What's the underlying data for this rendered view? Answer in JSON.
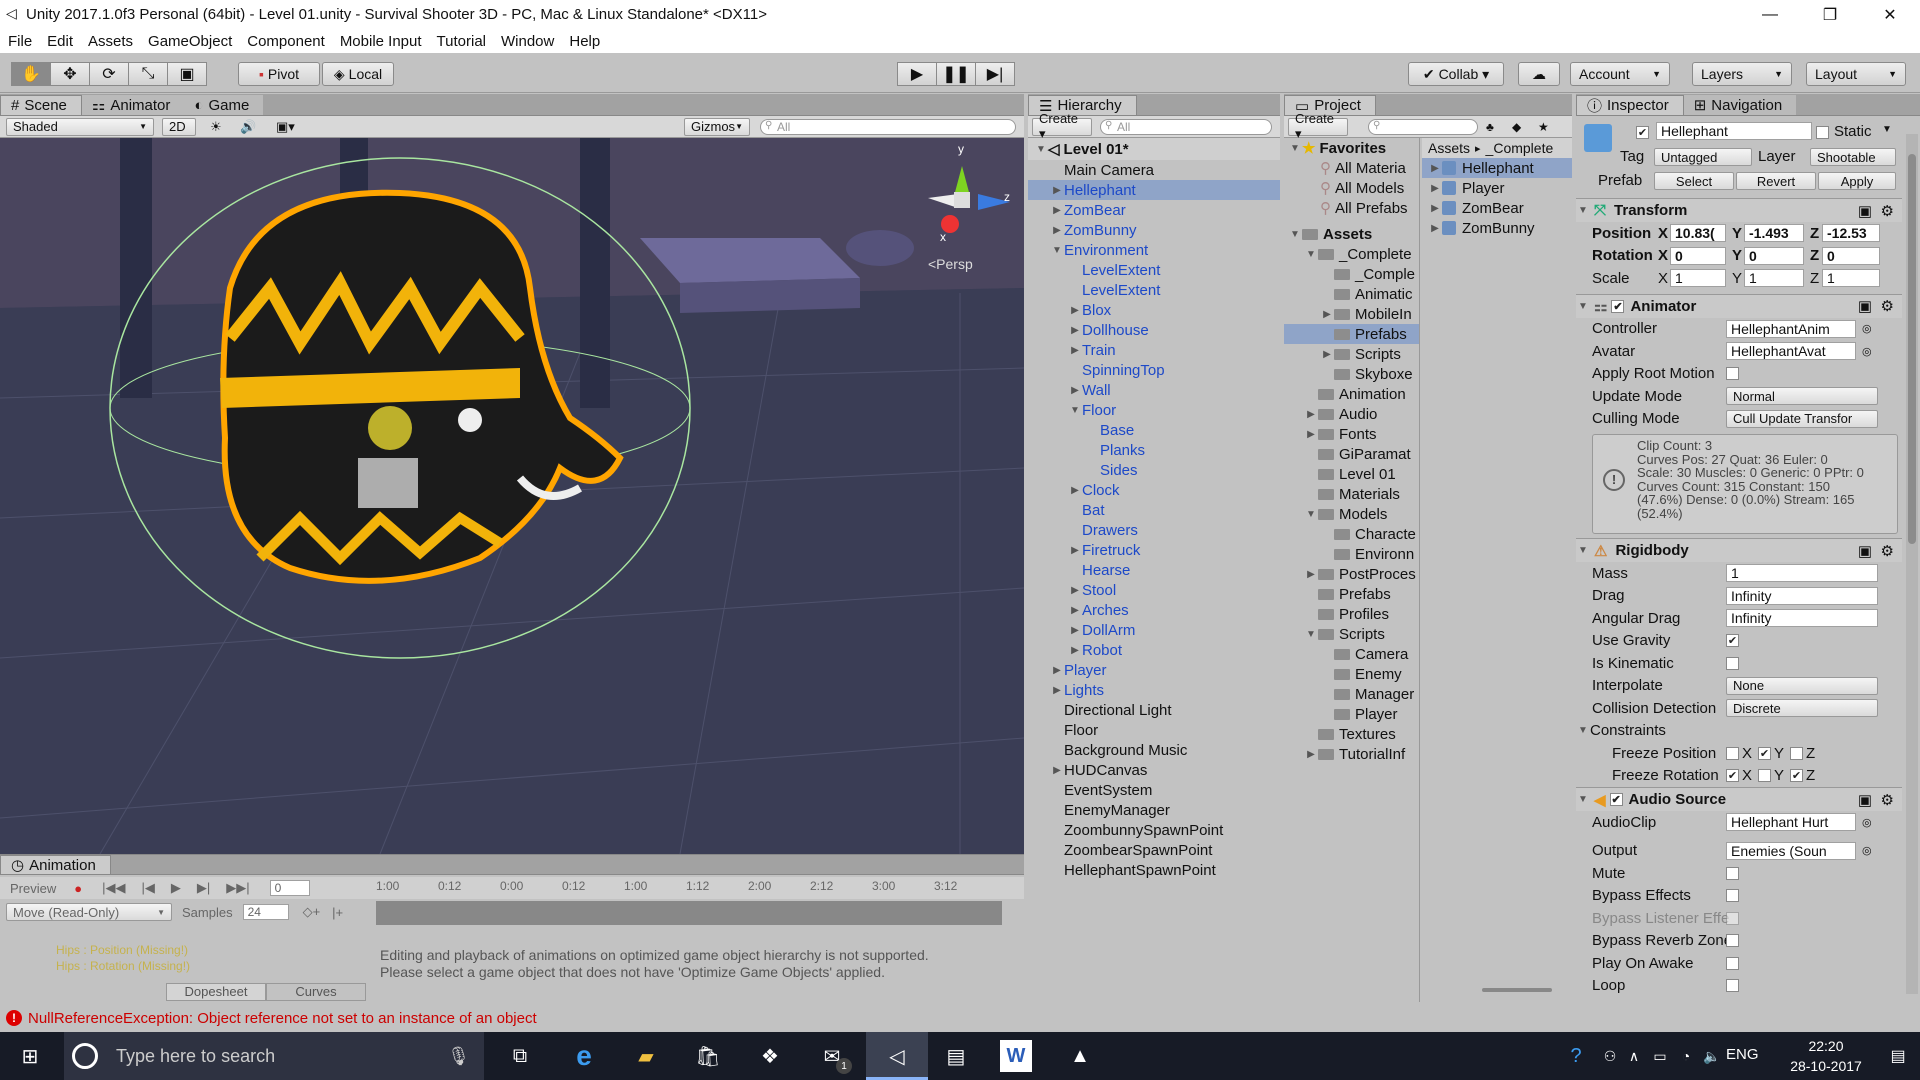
{
  "window": {
    "title": "Unity 2017.1.0f3 Personal (64bit) - Level 01.unity - Survival Shooter 3D - PC, Mac & Linux Standalone* <DX11>",
    "minimize": "—",
    "maximize": "❐",
    "close": "✕"
  },
  "menu": [
    "File",
    "Edit",
    "Assets",
    "GameObject",
    "Component",
    "Mobile Input",
    "Tutorial",
    "Window",
    "Help"
  ],
  "toolbar": {
    "pivot": "Pivot",
    "local": "Local",
    "collab": "Collab ▾",
    "account": "Account",
    "layers": "Layers",
    "layout": "Layout"
  },
  "scene": {
    "tabs": [
      "Scene",
      "Animator",
      "Game"
    ],
    "shading": "Shaded",
    "mode2d": "2D",
    "gizmos": "Gizmos",
    "search_placeholder": "All",
    "persp": "<Persp",
    "axis_y": "y",
    "axis_z": "z",
    "axis_x": "x"
  },
  "animation": {
    "tab": "Animation",
    "preview": "Preview",
    "frame": "0",
    "clip": "Move (Read-Only)",
    "samples_label": "Samples",
    "samples": "24",
    "ticks": [
      "1:00",
      "0:12",
      "0:00",
      "0:12",
      "1:00",
      "1:12",
      "2:00",
      "2:12",
      "3:00",
      "3:12"
    ],
    "tracks": [
      "Hips : Position (Missing!)",
      "Hips : Rotation (Missing!)"
    ],
    "message_1": "Editing and playback of animations on optimized game object hierarchy is not supported.",
    "message_2": "Please select a game object that does not have 'Optimize Game Objects' applied.",
    "dopesheet": "Dopesheet",
    "curves": "Curves"
  },
  "hierarchy": {
    "tab": "Hierarchy",
    "create": "Create ▾",
    "search_placeholder": "All",
    "scene": "Level 01*",
    "items": [
      {
        "label": "Main Camera",
        "indent": 0,
        "arrow": "",
        "blue": false,
        "sel": false
      },
      {
        "label": "Hellephant",
        "indent": 0,
        "arrow": "▶",
        "blue": true,
        "sel": true
      },
      {
        "label": "ZomBear",
        "indent": 0,
        "arrow": "▶",
        "blue": true,
        "sel": false
      },
      {
        "label": "ZomBunny",
        "indent": 0,
        "arrow": "▶",
        "blue": true,
        "sel": false
      },
      {
        "label": "Environment",
        "indent": 0,
        "arrow": "▼",
        "blue": true,
        "sel": false
      },
      {
        "label": "LevelExtent",
        "indent": 1,
        "arrow": "",
        "blue": true,
        "sel": false
      },
      {
        "label": "LevelExtent",
        "indent": 1,
        "arrow": "",
        "blue": true,
        "sel": false
      },
      {
        "label": "Blox",
        "indent": 1,
        "arrow": "▶",
        "blue": true,
        "sel": false
      },
      {
        "label": "Dollhouse",
        "indent": 1,
        "arrow": "▶",
        "blue": true,
        "sel": false
      },
      {
        "label": "Train",
        "indent": 1,
        "arrow": "▶",
        "blue": true,
        "sel": false
      },
      {
        "label": "SpinningTop",
        "indent": 1,
        "arrow": "",
        "blue": true,
        "sel": false
      },
      {
        "label": "Wall",
        "indent": 1,
        "arrow": "▶",
        "blue": true,
        "sel": false
      },
      {
        "label": "Floor",
        "indent": 1,
        "arrow": "▼",
        "blue": true,
        "sel": false
      },
      {
        "label": "Base",
        "indent": 2,
        "arrow": "",
        "blue": true,
        "sel": false
      },
      {
        "label": "Planks",
        "indent": 2,
        "arrow": "",
        "blue": true,
        "sel": false
      },
      {
        "label": "Sides",
        "indent": 2,
        "arrow": "",
        "blue": true,
        "sel": false
      },
      {
        "label": "Clock",
        "indent": 1,
        "arrow": "▶",
        "blue": true,
        "sel": false
      },
      {
        "label": "Bat",
        "indent": 1,
        "arrow": "",
        "blue": true,
        "sel": false
      },
      {
        "label": "Drawers",
        "indent": 1,
        "arrow": "",
        "blue": true,
        "sel": false
      },
      {
        "label": "Firetruck",
        "indent": 1,
        "arrow": "▶",
        "blue": true,
        "sel": false
      },
      {
        "label": "Hearse",
        "indent": 1,
        "arrow": "",
        "blue": true,
        "sel": false
      },
      {
        "label": "Stool",
        "indent": 1,
        "arrow": "▶",
        "blue": true,
        "sel": false
      },
      {
        "label": "Arches",
        "indent": 1,
        "arrow": "▶",
        "blue": true,
        "sel": false
      },
      {
        "label": "DollArm",
        "indent": 1,
        "arrow": "▶",
        "blue": true,
        "sel": false
      },
      {
        "label": "Robot",
        "indent": 1,
        "arrow": "▶",
        "blue": true,
        "sel": false
      },
      {
        "label": "Player",
        "indent": 0,
        "arrow": "▶",
        "blue": true,
        "sel": false
      },
      {
        "label": "Lights",
        "indent": 0,
        "arrow": "▶",
        "blue": true,
        "sel": false
      },
      {
        "label": "Directional Light",
        "indent": 0,
        "arrow": "",
        "blue": false,
        "sel": false
      },
      {
        "label": "Floor",
        "indent": 0,
        "arrow": "",
        "blue": false,
        "sel": false
      },
      {
        "label": "Background Music",
        "indent": 0,
        "arrow": "",
        "blue": false,
        "sel": false
      },
      {
        "label": "HUDCanvas",
        "indent": 0,
        "arrow": "▶",
        "blue": false,
        "sel": false
      },
      {
        "label": "EventSystem",
        "indent": 0,
        "arrow": "",
        "blue": false,
        "sel": false
      },
      {
        "label": "EnemyManager",
        "indent": 0,
        "arrow": "",
        "blue": false,
        "sel": false
      },
      {
        "label": "ZoombunnySpawnPoint",
        "indent": 0,
        "arrow": "",
        "blue": false,
        "sel": false
      },
      {
        "label": "ZoombearSpawnPoint",
        "indent": 0,
        "arrow": "",
        "blue": false,
        "sel": false
      },
      {
        "label": "HellephantSpawnPoint",
        "indent": 0,
        "arrow": "",
        "blue": false,
        "sel": false
      }
    ]
  },
  "project": {
    "tab": "Project",
    "create": "Create ▾",
    "favorites": "Favorites",
    "fav_items": [
      "All Materia",
      "All Models",
      "All Prefabs"
    ],
    "assets_label": "Assets",
    "tree": [
      {
        "label": "_Complete",
        "indent": 1,
        "arrow": "▼",
        "sel": false
      },
      {
        "label": "_Comple",
        "indent": 2,
        "arrow": "",
        "sel": false
      },
      {
        "label": "Animatic",
        "indent": 2,
        "arrow": "",
        "sel": false
      },
      {
        "label": "MobileIn",
        "indent": 2,
        "arrow": "▶",
        "sel": false
      },
      {
        "label": "Prefabs",
        "indent": 2,
        "arrow": "",
        "sel": true
      },
      {
        "label": "Scripts",
        "indent": 2,
        "arrow": "▶",
        "sel": false
      },
      {
        "label": "Skyboxe",
        "indent": 2,
        "arrow": "",
        "sel": false
      },
      {
        "label": "Animation",
        "indent": 1,
        "arrow": "",
        "sel": false
      },
      {
        "label": "Audio",
        "indent": 1,
        "arrow": "▶",
        "sel": false
      },
      {
        "label": "Fonts",
        "indent": 1,
        "arrow": "▶",
        "sel": false
      },
      {
        "label": "GiParamat",
        "indent": 1,
        "arrow": "",
        "sel": false
      },
      {
        "label": "Level 01",
        "indent": 1,
        "arrow": "",
        "sel": false
      },
      {
        "label": "Materials",
        "indent": 1,
        "arrow": "",
        "sel": false
      },
      {
        "label": "Models",
        "indent": 1,
        "arrow": "▼",
        "sel": false
      },
      {
        "label": "Characte",
        "indent": 2,
        "arrow": "",
        "sel": false
      },
      {
        "label": "Environn",
        "indent": 2,
        "arrow": "",
        "sel": false
      },
      {
        "label": "PostProces",
        "indent": 1,
        "arrow": "▶",
        "sel": false
      },
      {
        "label": "Prefabs",
        "indent": 1,
        "arrow": "",
        "sel": false
      },
      {
        "label": "Profiles",
        "indent": 1,
        "arrow": "",
        "sel": false
      },
      {
        "label": "Scripts",
        "indent": 1,
        "arrow": "▼",
        "sel": false
      },
      {
        "label": "Camera",
        "indent": 2,
        "arrow": "",
        "sel": false
      },
      {
        "label": "Enemy",
        "indent": 2,
        "arrow": "",
        "sel": false
      },
      {
        "label": "Manager",
        "indent": 2,
        "arrow": "",
        "sel": false
      },
      {
        "label": "Player",
        "indent": 2,
        "arrow": "",
        "sel": false
      },
      {
        "label": "Textures",
        "indent": 1,
        "arrow": "",
        "sel": false
      },
      {
        "label": "TutorialInf",
        "indent": 1,
        "arrow": "▶",
        "sel": false
      }
    ],
    "breadcrumb_1": "Assets",
    "breadcrumb_sep": "▸",
    "breadcrumb_2": "_Complete",
    "files": [
      {
        "label": "Hellephant",
        "sel": true
      },
      {
        "label": "Player",
        "sel": false
      },
      {
        "label": "ZomBear",
        "sel": false
      },
      {
        "label": "ZomBunny",
        "sel": false
      }
    ]
  },
  "inspector": {
    "tab": "Inspector",
    "tab2": "Navigation",
    "name": "Hellephant",
    "static": "Static",
    "tag_label": "Tag",
    "tag": "Untagged",
    "layer_label": "Layer",
    "layer": "Shootable",
    "prefab_label": "Prefab",
    "select": "Select",
    "revert": "Revert",
    "apply": "Apply",
    "transform": {
      "title": "Transform",
      "position_label": "Position",
      "pos_x": "10.83(",
      "pos_y": "-1.493",
      "pos_z": "-12.53",
      "rotation_label": "Rotation",
      "rot_x": "0",
      "rot_y": "0",
      "rot_z": "0",
      "scale_label": "Scale",
      "scl_x": "1",
      "scl_y": "1",
      "scl_z": "1"
    },
    "animator": {
      "title": "Animator",
      "controller_label": "Controller",
      "controller": "HellephantAnim",
      "avatar_label": "Avatar",
      "avatar": "HellephantAvat",
      "apply_root_label": "Apply Root Motion",
      "update_label": "Update Mode",
      "update": "Normal",
      "culling_label": "Culling Mode",
      "culling": "Cull Update Transfor",
      "info": [
        "Clip Count: 3",
        "Curves Pos: 27 Quat: 36 Euler: 0",
        "Scale: 30 Muscles: 0 Generic: 0 PPtr: 0",
        "Curves Count: 315 Constant: 150",
        "(47.6%) Dense: 0 (0.0%) Stream: 165",
        "(52.4%)"
      ]
    },
    "rigidbody": {
      "title": "Rigidbody",
      "mass_label": "Mass",
      "mass": "1",
      "drag_label": "Drag",
      "drag": "Infinity",
      "angdrag_label": "Angular Drag",
      "angdrag": "Infinity",
      "gravity_label": "Use Gravity",
      "kinematic_label": "Is Kinematic",
      "interp_label": "Interpolate",
      "interp": "None",
      "collision_label": "Collision Detection",
      "collision": "Discrete",
      "constraints_label": "Constraints",
      "freeze_pos_label": "Freeze Position",
      "freeze_rot_label": "Freeze Rotation",
      "ax_x": "X",
      "ax_y": "Y",
      "ax_z": "Z"
    },
    "audio": {
      "title": "Audio Source",
      "clip_label": "AudioClip",
      "clip": "Hellephant Hurt",
      "output_label": "Output",
      "output": "Enemies (Soun",
      "mute_label": "Mute",
      "bypass_label": "Bypass Effects",
      "bypass_listener_label": "Bypass Listener Effe",
      "bypass_reverb_label": "Bypass Reverb Zone",
      "play_awake_label": "Play On Awake",
      "loop_label": "Loop"
    }
  },
  "status": {
    "error": "NullReferenceException: Object reference not set to an instance of an object"
  },
  "taskbar": {
    "search_placeholder": "Type here to search",
    "lang": "ENG",
    "time": "22:20",
    "date": "28-10-2017",
    "mail_badge": "1"
  },
  "colors": {
    "accent_selection": "#8fa4c8",
    "prefab_blue": "#1d49c8",
    "error_red": "#cc0000",
    "scene_bg": "#3a3f57",
    "outline_orange": "#ffa500"
  }
}
